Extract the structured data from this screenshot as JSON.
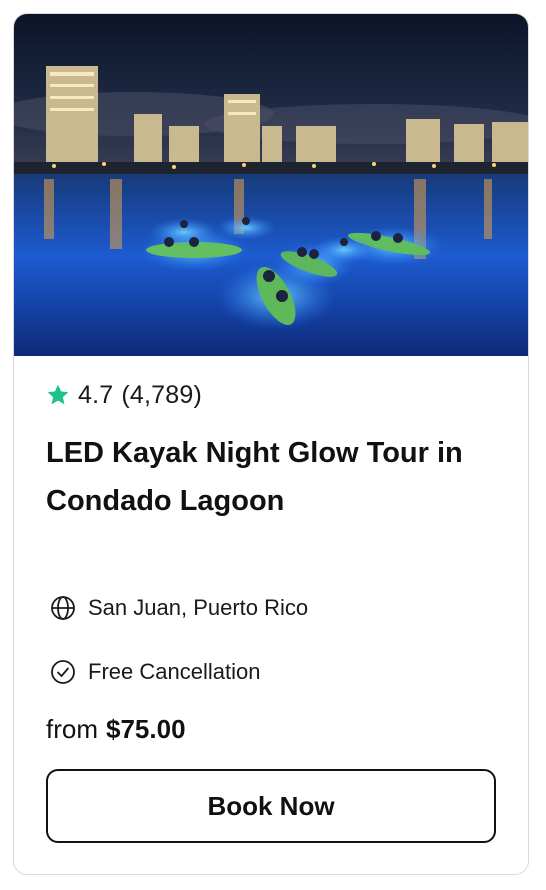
{
  "card": {
    "image_alt": "Kayaks glowing on a lagoon at night with city skyline",
    "rating": {
      "icon": "star-icon",
      "score": "4.7",
      "count": "(4,789)",
      "color": "#1ec28b"
    },
    "title": "LED Kayak Night Glow Tour in Condado Lagoon",
    "location": {
      "icon": "globe-icon",
      "text": "San Juan, Puerto Rico"
    },
    "cancellation": {
      "icon": "check-circle-icon",
      "text": "Free Cancellation"
    },
    "price": {
      "prefix": "from",
      "amount": "$75.00"
    },
    "button_label": "Book Now"
  }
}
